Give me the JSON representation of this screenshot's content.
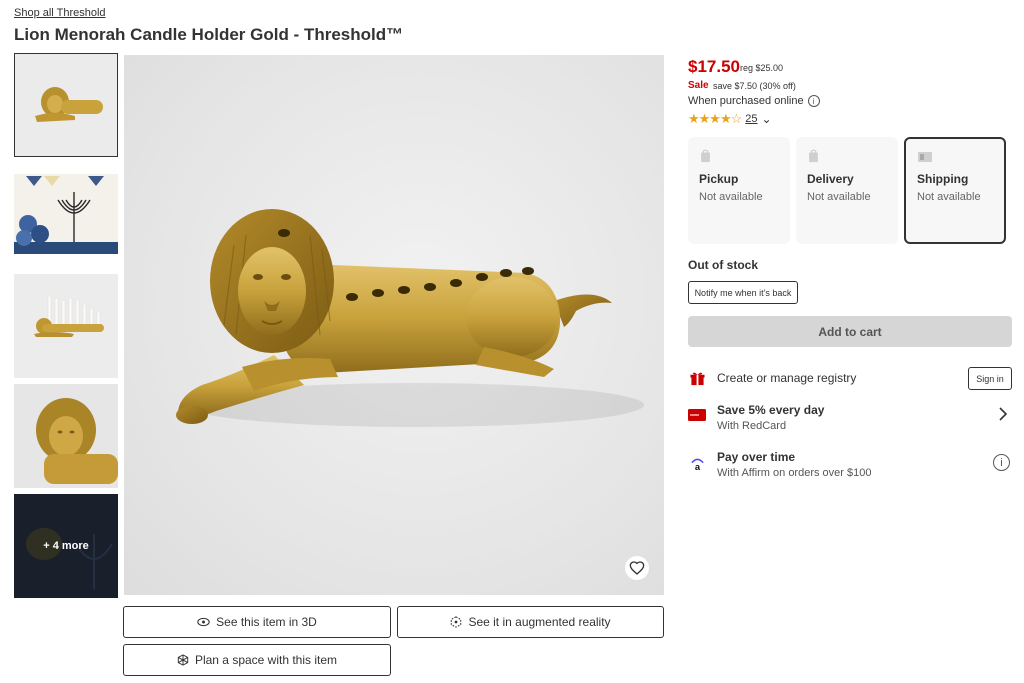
{
  "breadcrumb": "Shop all Threshold",
  "title": "Lion Menorah Candle Holder Gold - Threshold™",
  "thumbnails": {
    "more_label": "+ 4 more"
  },
  "actions": {
    "view_3d": "See this item in 3D",
    "ar": "See it in augmented reality",
    "plan_space": "Plan a space with this item"
  },
  "price": {
    "current": "$17.50",
    "regular": "reg $25.00",
    "sale_label": "Sale",
    "savings": "save $7.50 (30% off)",
    "when_purchased": "When purchased online",
    "info_glyph": "i"
  },
  "rating": {
    "stars": "★★★★☆",
    "value": 4.5,
    "count": "25",
    "chevron": "⌄"
  },
  "fulfillment": [
    {
      "label": "Pickup",
      "status": "Not available",
      "icon": "store-icon"
    },
    {
      "label": "Delivery",
      "status": "Not available",
      "icon": "bag-icon"
    },
    {
      "label": "Shipping",
      "status": "Not available",
      "icon": "box-icon"
    }
  ],
  "stock": {
    "status": "Out of stock",
    "notify_label": "Notify me when it’s back"
  },
  "add_to_cart": "Add to cart",
  "registry": {
    "label": "Create or manage registry",
    "sign_in": "Sign in"
  },
  "redcard": {
    "title": "Save 5% every day",
    "subtitle": "With RedCard"
  },
  "affirm": {
    "title": "Pay over time",
    "subtitle": "With Affirm on orders over $100",
    "info_glyph": "i"
  },
  "colors": {
    "price_red": "#cc0000",
    "star_gold": "#e8a317",
    "brass": "#c9a23c",
    "disabled_gray": "#d6d6d6"
  }
}
